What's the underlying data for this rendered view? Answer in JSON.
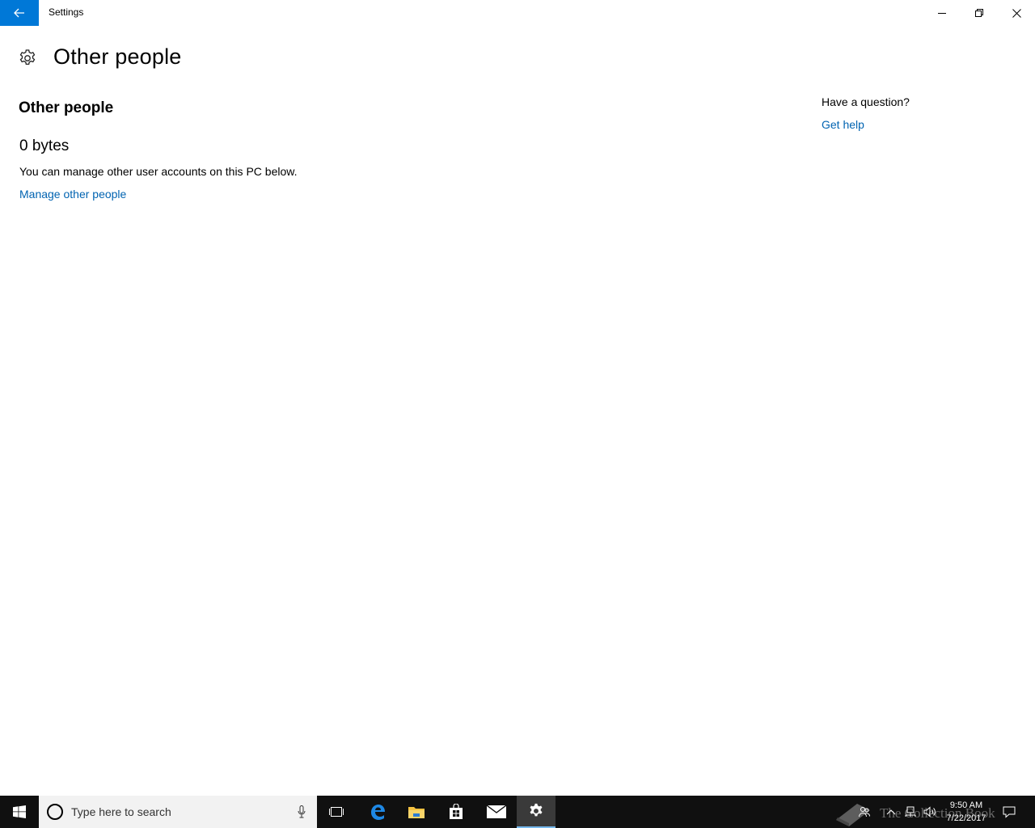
{
  "window": {
    "title": "Settings",
    "back_icon": "back-arrow-icon",
    "controls": [
      "minimize",
      "restore",
      "close"
    ]
  },
  "header": {
    "icon": "gear-icon",
    "title": "Other people"
  },
  "main": {
    "section_title": "Other people",
    "size_value": "0 bytes",
    "description": "You can manage other user accounts on this PC below.",
    "manage_link": "Manage other people"
  },
  "help": {
    "question": "Have a question?",
    "link": "Get help"
  },
  "taskbar": {
    "search_placeholder": "Type here to search",
    "pinned": [
      "task-view",
      "edge",
      "file-explorer",
      "store",
      "mail",
      "settings"
    ],
    "active_app": "settings",
    "watermark": "The Collection Book",
    "time": "9:50 AM",
    "date": "7/22/2017"
  },
  "colors": {
    "accent": "#0078d7",
    "link": "#0063b1",
    "taskbar_bg": "#101010"
  }
}
